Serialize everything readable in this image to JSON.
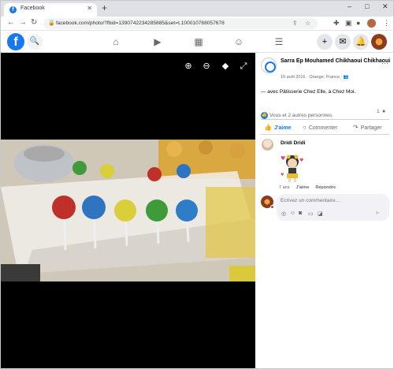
{
  "browser": {
    "tab_title": "Facebook",
    "tab_favicon": "f",
    "tab_close": "✕",
    "new_tab": "+",
    "url": "facebook.com/photo/?fbid=1390742234285885&set=t.100010768057678",
    "window_controls": [
      "–",
      "□",
      "✕"
    ]
  },
  "facebook_header": {
    "logo": "f",
    "nav_icons": [
      "home-icon",
      "watch-icon",
      "marketplace-icon",
      "groups-icon",
      "menu-icon"
    ],
    "nav_glyphs": [
      "⌂",
      "▶",
      "▦",
      "☺",
      "☰"
    ],
    "right_buttons": [
      "+",
      "✉",
      "🔔"
    ]
  },
  "post": {
    "author": "Sarra Ep Mouhamed Chikhaoui Chikhaoui",
    "meta": "19 avril 2016 · Orange, France · 👥",
    "caption": "— avec Pâtisserie Chez Elle, à Chez Moi.",
    "reactions_text": "Vous et 2 autres personnes",
    "comment_count": "1",
    "actions": {
      "like": "J'aime",
      "comment": "Commenter",
      "share": "Partager"
    }
  },
  "comment": {
    "author": "Dridi Dridi",
    "age": "7 ans",
    "like": "J'aime",
    "reply": "Répondre"
  },
  "composer": {
    "placeholder": "Écrivez un commentaire…"
  },
  "colors": {
    "facebook_blue": "#1877f2",
    "secondary_text": "#65676b",
    "viewer_background": "#000000"
  }
}
